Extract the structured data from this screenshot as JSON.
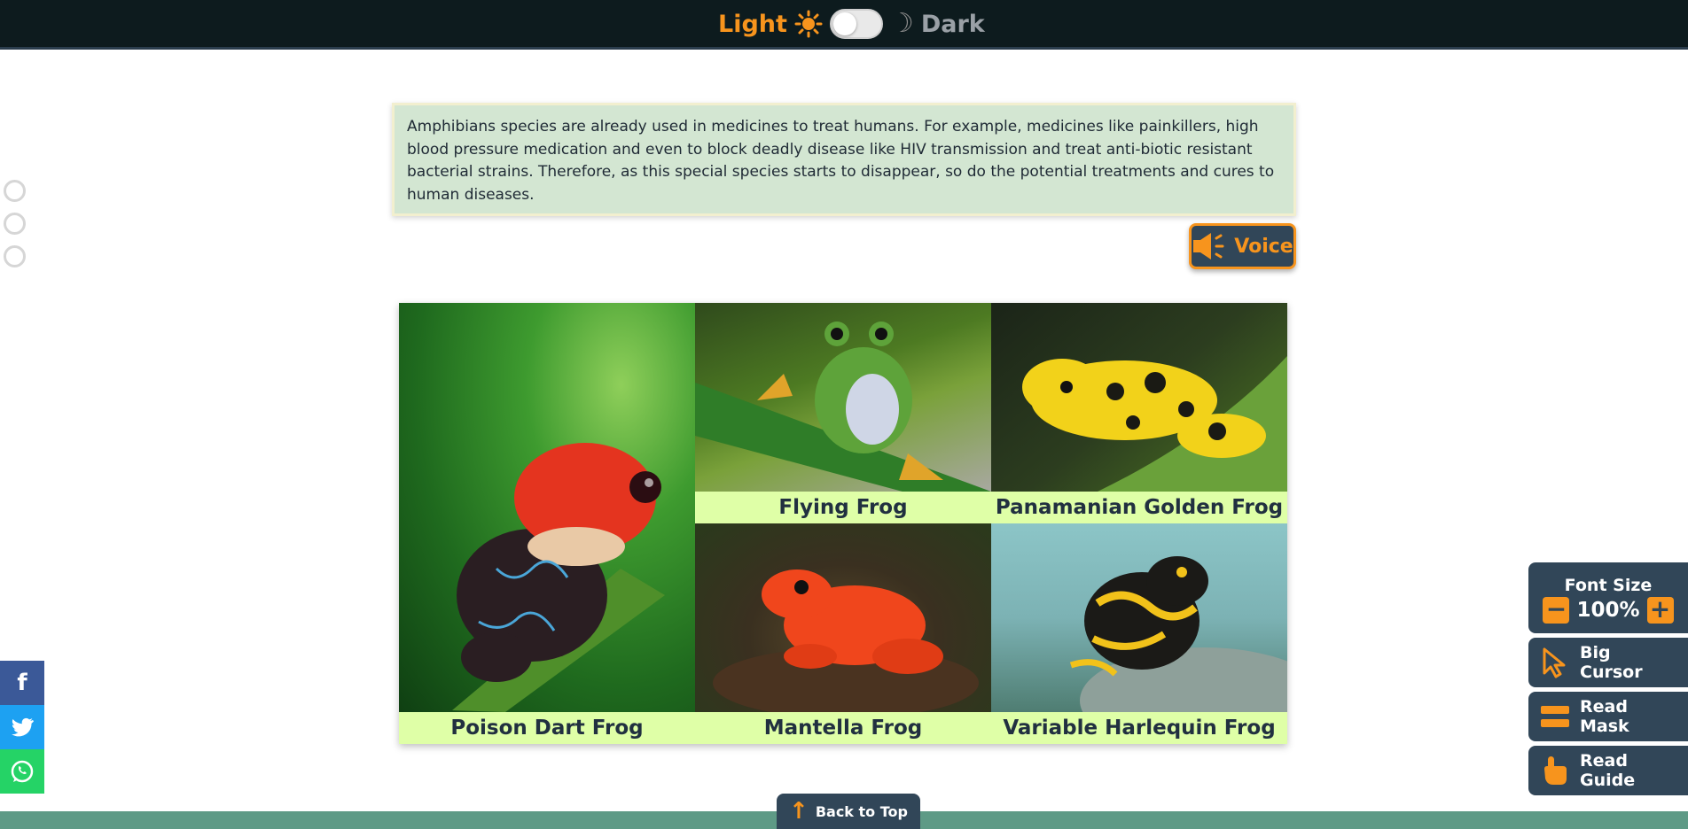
{
  "theme": {
    "light_label": "Light",
    "dark_label": "Dark",
    "icons": {
      "light": "sun-icon",
      "dark": "moon-icon"
    }
  },
  "info": {
    "text": "Amphibians species are already used in medicines to treat humans. For example, medicines like painkillers, high blood pressure medication and even to block deadly disease like HIV transmission and treat anti-biotic resistant bacterial strains. Therefore, as this special species starts to disappear, so do the potential treatments and cures to human diseases."
  },
  "voice": {
    "label": "Voice",
    "icon": "speaker-icon"
  },
  "gallery": {
    "items": [
      {
        "caption": "Poison Dart Frog"
      },
      {
        "caption": "Flying Frog"
      },
      {
        "caption": "Panamanian Golden Frog"
      },
      {
        "caption": "Mantella Frog"
      },
      {
        "caption": "Variable Harlequin Frog"
      }
    ]
  },
  "social": {
    "facebook": "f",
    "twitter": "twitter-icon",
    "whatsapp": "whatsapp-icon"
  },
  "tools": {
    "font_size_title": "Font Size",
    "font_size_value": "100%",
    "decrease": "−",
    "increase": "+",
    "big_cursor": "Big Cursor",
    "read_mask": "Read Mask",
    "read_guide": "Read Guide"
  },
  "back_to_top": {
    "label": "Back to Top"
  },
  "colors": {
    "accent": "#f7941d",
    "panel": "#314658",
    "info_bg": "#d3e6d2",
    "caption_bg": "#dfffa7",
    "topbar": "#0d1b1e"
  }
}
